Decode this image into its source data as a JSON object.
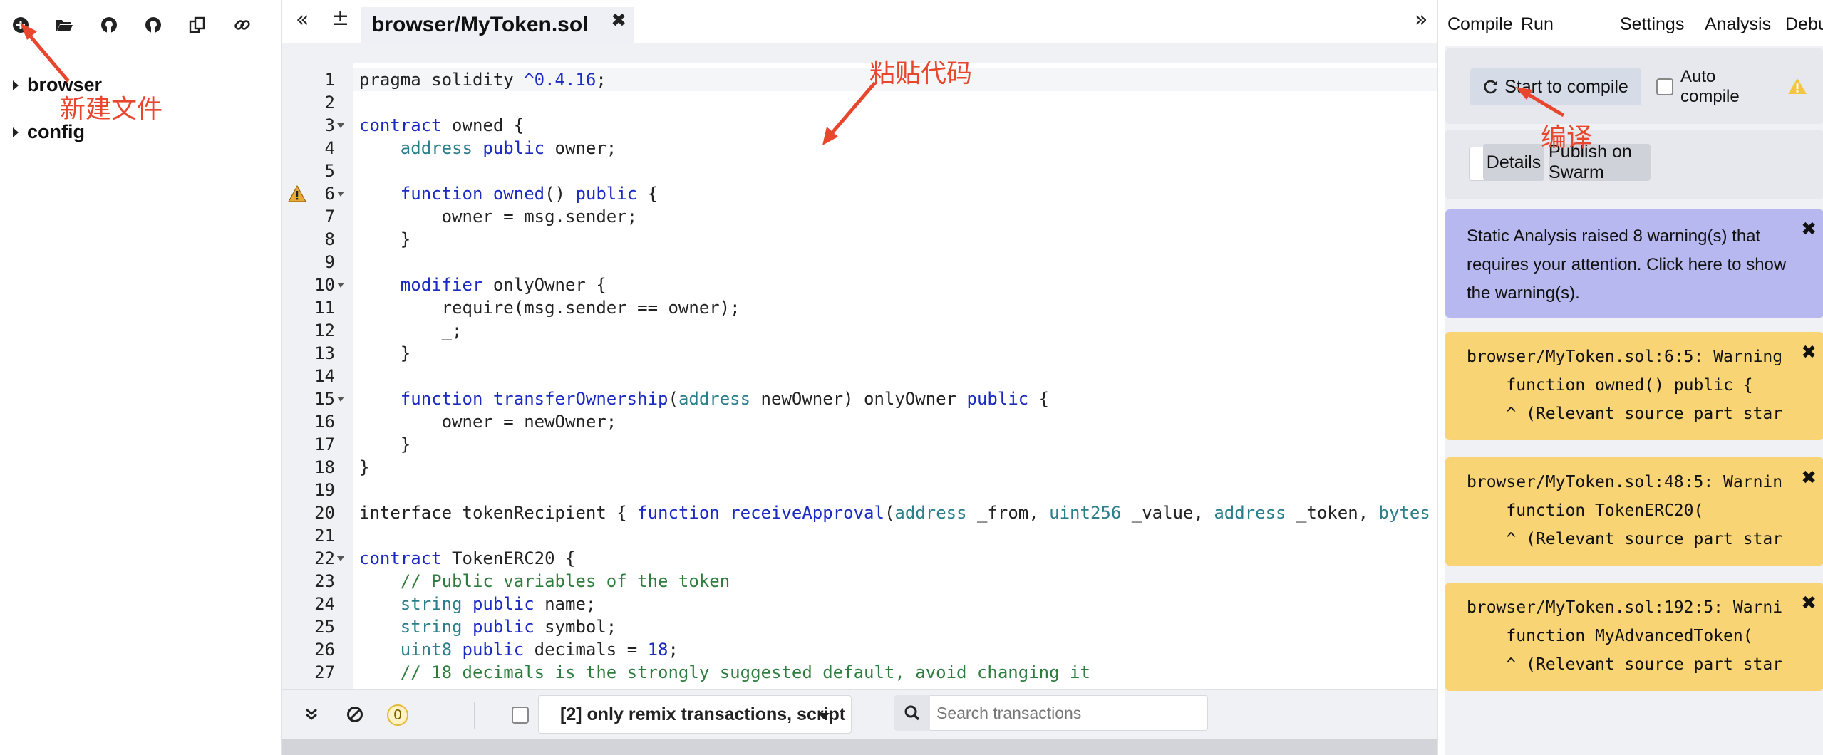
{
  "left_panel": {
    "toolbar_icons": [
      "create-file-icon",
      "open-folder-icon",
      "github-icon",
      "gist-icon",
      "copy-to-icon",
      "connect-localhost-icon"
    ],
    "tree": [
      {
        "label": "browser"
      },
      {
        "label": "config"
      }
    ]
  },
  "editor": {
    "collapse_left": "«",
    "zoom": "±",
    "collapse_right": "»",
    "file_tab": {
      "label": "browser/MyToken.sol",
      "close": "✖"
    },
    "line_numbers": [
      "1",
      "2",
      "3",
      "4",
      "5",
      "6",
      "7",
      "8",
      "9",
      "10",
      "11",
      "12",
      "13",
      "14",
      "15",
      "16",
      "17",
      "18",
      "19",
      "20",
      "21",
      "22",
      "23",
      "24",
      "25",
      "26",
      "27"
    ],
    "warning_line": "6",
    "code_lines": [
      "pragma solidity ^0.4.16;",
      "",
      "contract owned {",
      "    address public owner;",
      "",
      "    function owned() public {",
      "        owner = msg.sender;",
      "    }",
      "",
      "    modifier onlyOwner {",
      "        require(msg.sender == owner);",
      "        _;",
      "    }",
      "",
      "    function transferOwnership(address newOwner) onlyOwner public {",
      "        owner = newOwner;",
      "    }",
      "}",
      "",
      "interface tokenRecipient { function receiveApproval(address _from, uint256 _value, address _token, bytes _",
      "",
      "contract TokenERC20 {",
      "    // Public variables of the token",
      "    string public name;",
      "    string public symbol;",
      "    uint8 public decimals = 18;",
      "    // 18 decimals is the strongly suggested default, avoid changing it"
    ]
  },
  "terminal_bar": {
    "pending_count": "0",
    "filter_label": "[2] only remix transactions, script",
    "search_placeholder": "Search transactions"
  },
  "right_panel": {
    "tabs": [
      "Compile",
      "Run",
      "Settings",
      "Analysis",
      "Debu"
    ],
    "compile_button": "Start to compile",
    "auto_compile": "Auto compile",
    "details_button": "Details",
    "publish_button": "Publish on Swarm",
    "static_alert": "Static Analysis raised 8 warning(s) that requires your attention. Click here to show the warning(s).",
    "close_glyph": "✖",
    "warnings": [
      {
        "line1": "browser/MyToken.sol:6:5: Warning",
        "line2": "    function owned() public {",
        "line3": "    ^ (Relevant source part star"
      },
      {
        "line1": "browser/MyToken.sol:48:5: Warnin",
        "line2": "    function TokenERC20(",
        "line3": "    ^ (Relevant source part star"
      },
      {
        "line1": "browser/MyToken.sol:192:5: Warni",
        "line2": "    function MyAdvancedToken(",
        "line3": "    ^ (Relevant source part star"
      }
    ]
  },
  "annotations": {
    "new_file": "新建文件",
    "paste_code": "粘贴代码",
    "compile": "编译"
  },
  "colors": {
    "annotation_red": "#e8462d",
    "keyword_blue": "#1a2ac2",
    "type_teal": "#2c7f8a",
    "comment_green": "#2f7d3e",
    "alert_purple": "#b7b8f0",
    "warning_yellow": "#f8d475",
    "panel_grey": "#f0f1f4"
  }
}
